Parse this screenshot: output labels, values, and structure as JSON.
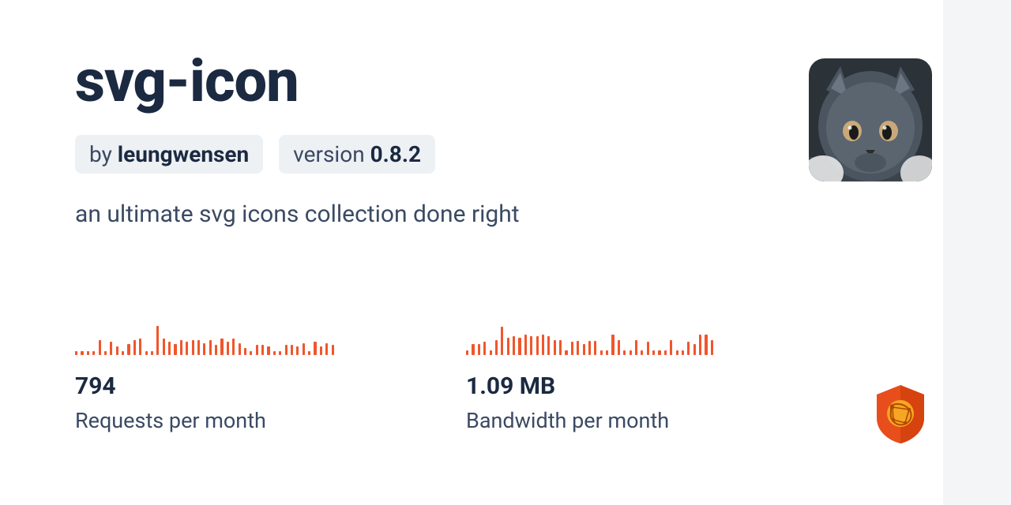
{
  "package": {
    "name": "svg-icon",
    "by_label": "by ",
    "author": "leungwensen",
    "version_label": "version ",
    "version": "0.8.2",
    "description": "an ultimate svg icons collection done right"
  },
  "stats": {
    "requests": {
      "value": "794",
      "label": "Requests per month"
    },
    "bandwidth": {
      "value": "1.09 MB",
      "label": "Bandwidth per month"
    }
  },
  "chart_data": [
    {
      "type": "bar",
      "title": "Requests per month sparkline",
      "categories": [
        1,
        2,
        3,
        4,
        5,
        6,
        7,
        8,
        9,
        10,
        11,
        12,
        13,
        14,
        15,
        16,
        17,
        18,
        19,
        20,
        21,
        22,
        23,
        24,
        25,
        26,
        27,
        28,
        29,
        30,
        31,
        32,
        33,
        34,
        35,
        36,
        37,
        38,
        39,
        40,
        41,
        42,
        43,
        44,
        45
      ],
      "values": [
        5,
        5,
        5,
        5,
        20,
        5,
        18,
        12,
        5,
        15,
        20,
        22,
        5,
        5,
        40,
        22,
        18,
        15,
        20,
        18,
        20,
        20,
        16,
        20,
        14,
        22,
        18,
        22,
        16,
        10,
        5,
        14,
        14,
        12,
        5,
        5,
        14,
        14,
        12,
        16,
        5,
        18,
        12,
        16,
        14
      ],
      "ylim": [
        0,
        45
      ]
    },
    {
      "type": "bar",
      "title": "Bandwidth per month sparkline",
      "categories": [
        1,
        2,
        3,
        4,
        5,
        6,
        7,
        8,
        9,
        10,
        11,
        12,
        13,
        14,
        15,
        16,
        17,
        18,
        19,
        20,
        21,
        22,
        23,
        24,
        25,
        26,
        27,
        28,
        29,
        30,
        31,
        32,
        33,
        34,
        35,
        36,
        37,
        38,
        39,
        40,
        41,
        42,
        43
      ],
      "values": [
        5,
        12,
        12,
        14,
        5,
        16,
        30,
        18,
        20,
        18,
        22,
        20,
        20,
        22,
        20,
        16,
        16,
        5,
        14,
        15,
        12,
        15,
        15,
        5,
        5,
        22,
        16,
        5,
        5,
        16,
        5,
        14,
        5,
        5,
        5,
        16,
        5,
        5,
        14,
        12,
        22,
        22,
        16
      ],
      "ylim": [
        0,
        35
      ]
    }
  ],
  "colors": {
    "accent": "#f0562b",
    "text_primary": "#1b2a41",
    "text_secondary": "#3a4a63",
    "chip_bg": "#eef1f4"
  }
}
